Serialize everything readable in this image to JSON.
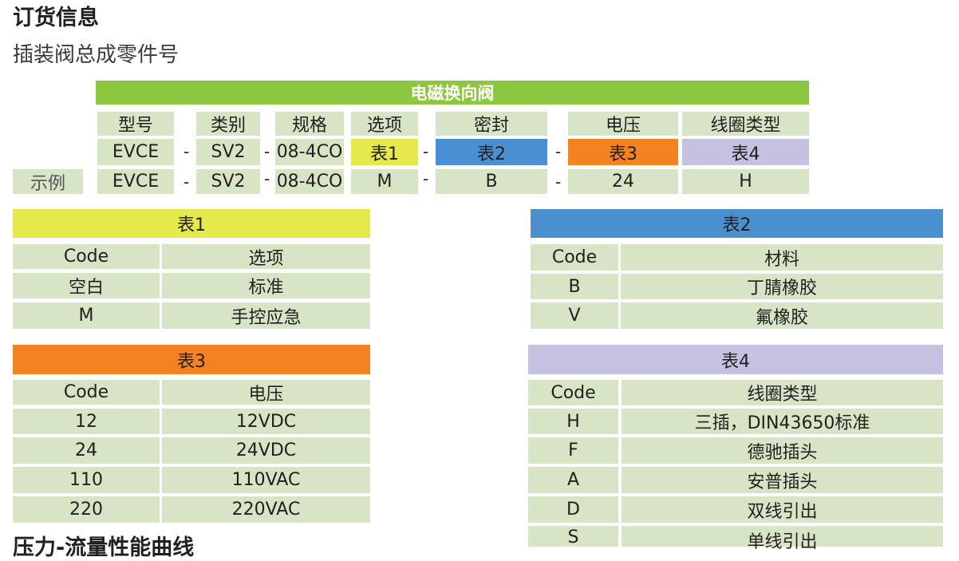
{
  "title": "订货信息",
  "subtitle": "插装阀总成零件号",
  "model_table": {
    "header": "电磁换向阀",
    "columns": [
      "型号",
      "类别",
      "规格",
      "选项",
      "密封",
      "电压",
      "线圈类型"
    ],
    "code_row": [
      "EVCE",
      "SV2",
      "08-4CO",
      "表1",
      "表2",
      "表3",
      "表4"
    ],
    "example_label": "示例",
    "example_row": [
      "EVCE",
      "SV2",
      "08-4CO",
      "M",
      "B",
      "24",
      "H"
    ],
    "separator": "-"
  },
  "table1": {
    "title": "表1",
    "headers": [
      "Code",
      "选项"
    ],
    "rows": [
      [
        "空白",
        "标准"
      ],
      [
        "M",
        "手控应急"
      ]
    ]
  },
  "table2": {
    "title": "表2",
    "headers": [
      "Code",
      "材料"
    ],
    "rows": [
      [
        "B",
        "丁腈橡胶"
      ],
      [
        "V",
        "氟橡胶"
      ]
    ]
  },
  "table3": {
    "title": "表3",
    "headers": [
      "Code",
      "电压"
    ],
    "rows": [
      [
        "12",
        "12VDC"
      ],
      [
        "24",
        "24VDC"
      ],
      [
        "110",
        "110VAC"
      ],
      [
        "220",
        "220VAC"
      ]
    ]
  },
  "table4": {
    "title": "表4",
    "headers": [
      "Code",
      "线圈类型"
    ],
    "rows": [
      [
        "H",
        "三插，DIN43650标准"
      ],
      [
        "F",
        "德驰插头"
      ],
      [
        "A",
        "安普插头"
      ],
      [
        "D",
        "双线引出"
      ],
      [
        "S",
        "单线引出"
      ]
    ]
  },
  "next_section_title": "压力-流量性能曲线",
  "colors": {
    "green_header": "#8dc63f",
    "cell_bg": "#d7e4c6",
    "table1": "#e5e94a",
    "table2": "#4a8fd0",
    "table3": "#f58220",
    "table4": "#c5c1e1"
  }
}
